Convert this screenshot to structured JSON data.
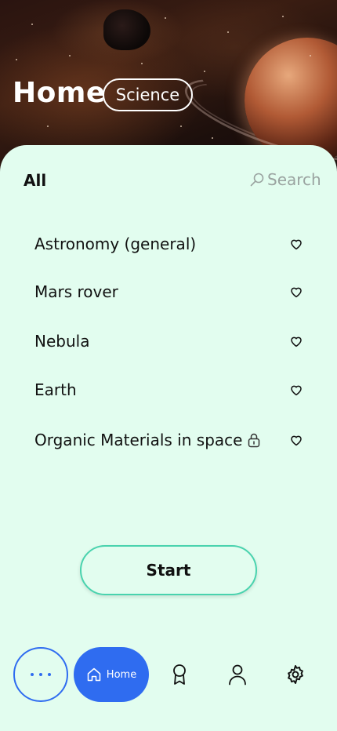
{
  "header": {
    "title": "Home",
    "category_chip": "Science"
  },
  "filters": {
    "active": "All",
    "search_label": "Search"
  },
  "topics": [
    {
      "label": "Astronomy (general)",
      "locked": false,
      "favorite": false
    },
    {
      "label": "Mars rover",
      "locked": false,
      "favorite": false
    },
    {
      "label": "Nebula",
      "locked": false,
      "favorite": false
    },
    {
      "label": "Earth",
      "locked": false,
      "favorite": false
    },
    {
      "label": "Organic Materials in space",
      "locked": true,
      "favorite": false
    }
  ],
  "start_button": "Start",
  "bottom_nav": {
    "more_icon": "more-dots-icon",
    "home_label": "Home",
    "items": [
      "home-icon",
      "award-icon",
      "profile-icon",
      "gear-icon"
    ]
  },
  "colors": {
    "background": "#e2fdef",
    "accent_blue": "#2f6cf0",
    "start_border": "#49d3ae"
  }
}
